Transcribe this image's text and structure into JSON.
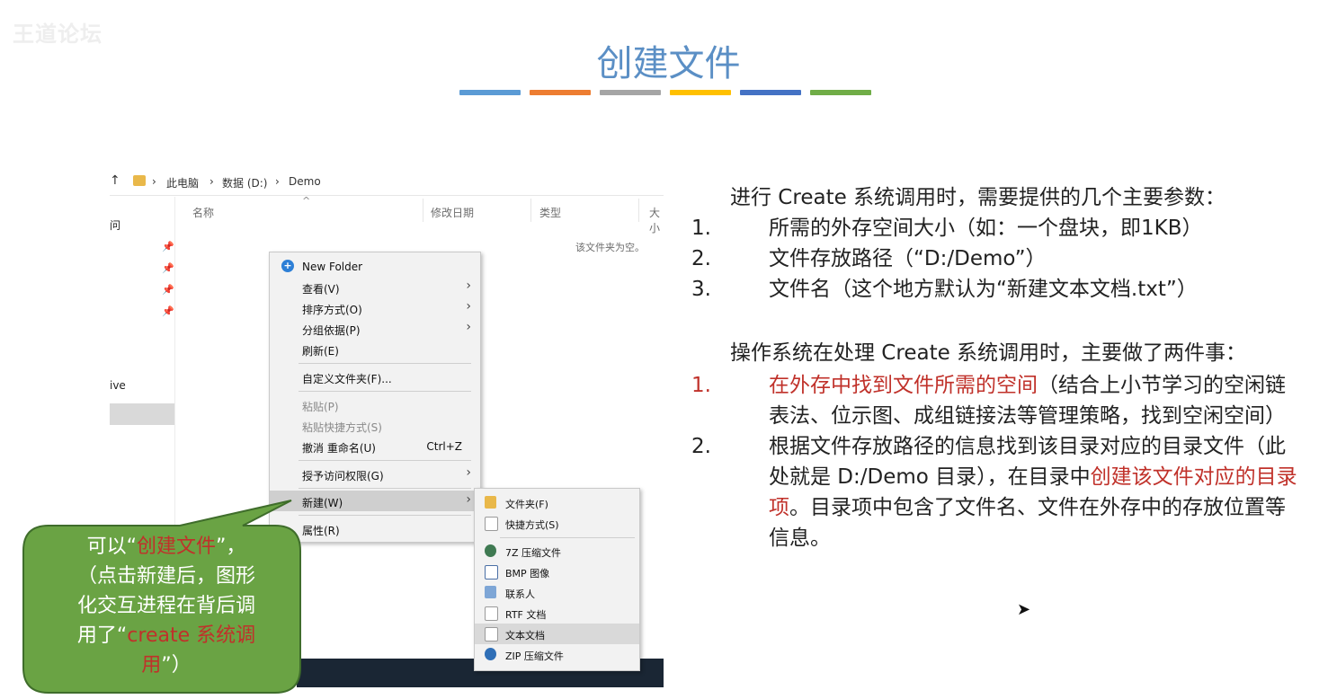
{
  "watermark": "王道论坛",
  "slide": {
    "title": "创建文件",
    "bar_colors": [
      "#5b9bd5",
      "#ed7d31",
      "#a5a5a5",
      "#ffc000",
      "#4472c4",
      "#70ad47"
    ]
  },
  "explorer": {
    "breadcrumb": [
      "此电脑",
      "数据 (D:)",
      "Demo"
    ],
    "sidebar_labels": [
      "问",
      "ive"
    ],
    "columns": [
      "名称",
      "修改日期",
      "类型",
      "大小"
    ],
    "empty_text": "该文件夹为空。"
  },
  "context_menu": {
    "items": [
      {
        "label": "New Folder"
      },
      {
        "label": "查看(V)"
      },
      {
        "label": "排序方式(O)"
      },
      {
        "label": "分组依据(P)"
      },
      {
        "label": "刷新(E)"
      },
      {
        "label": "自定义文件夹(F)..."
      },
      {
        "label": "粘贴(P)"
      },
      {
        "label": "粘贴快捷方式(S)"
      },
      {
        "label": "撤消 重命名(U)",
        "shortcut": "Ctrl+Z"
      },
      {
        "label": "授予访问权限(G)"
      },
      {
        "label": "新建(W)"
      },
      {
        "label": "属性(R)"
      }
    ]
  },
  "new_submenu": {
    "items": [
      {
        "label": "文件夹(F)"
      },
      {
        "label": "快捷方式(S)"
      },
      {
        "label": "7Z 压缩文件"
      },
      {
        "label": "BMP 图像"
      },
      {
        "label": "联系人"
      },
      {
        "label": "RTF 文档"
      },
      {
        "label": "文本文档"
      },
      {
        "label": "ZIP 压缩文件"
      }
    ]
  },
  "bubble": {
    "line1_pre": "可以“",
    "line1_red": "创建文件",
    "line1_post": "”，",
    "line2": "（点击新建后，图形",
    "line3": "化交互进程在背后调",
    "line4_pre": "用了“",
    "line4_red": "create 系统调",
    "line5_red": "用",
    "line5_post": "”）"
  },
  "right_text": {
    "intro": "进行 Create 系统调用时，需要提供的几个主要参数：",
    "params": [
      {
        "num": "1.",
        "text": "所需的外存空间大小（如：一个盘块，即1KB）"
      },
      {
        "num": "2.",
        "text": "文件存放路径（“D:/Demo”）"
      },
      {
        "num": "3.",
        "text": "文件名（这个地方默认为“新建文本文档.txt”）"
      }
    ],
    "os_intro": "操作系统在处理 Create 系统调用时，主要做了两件事：",
    "steps": [
      {
        "num": "1.",
        "red": "在外存中找到文件所需的空间",
        "rest": "（结合上小节学习的空闲链表法、位示图、成组链接法等管理策略，找到空闲空间）"
      },
      {
        "num": "2.",
        "pre": "根据文件存放路径的信息找到该目录对应的目录文件（此处就是 D:/Demo 目录），在目录中",
        "red": "创建该文件对应的目录项",
        "post": "。目录项中包含了文件名、文件在外存中的存放位置等信息。"
      }
    ]
  }
}
